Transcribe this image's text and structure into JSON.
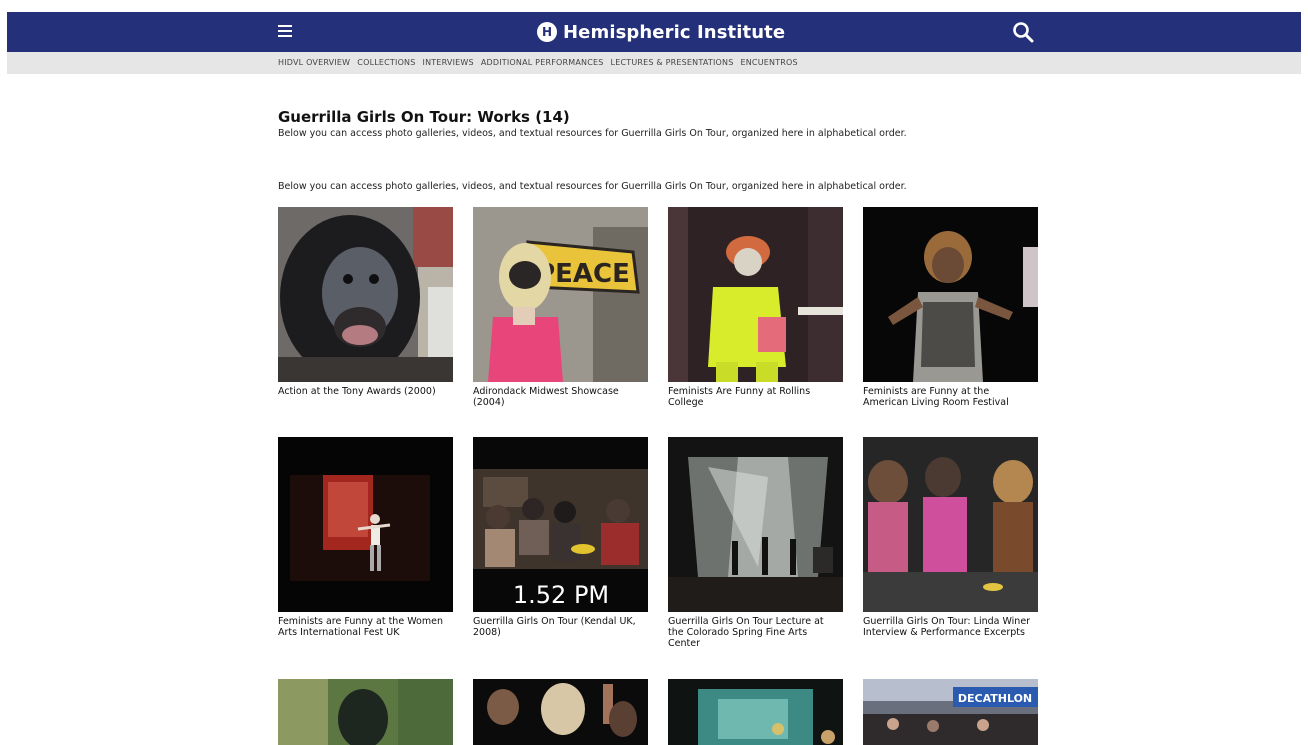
{
  "header": {
    "brand_name": "Hemispheric Institute",
    "brand_logo_letter": "H",
    "background_color": "#25307a",
    "menu_icon": "hamburger-icon",
    "search_icon": "search-icon"
  },
  "subnav": {
    "items": [
      "HIDVL OVERVIEW",
      "COLLECTIONS",
      "INTERVIEWS",
      "ADDITIONAL PERFORMANCES",
      "LECTURES & PRESENTATIONS",
      "ENCUENTROS"
    ]
  },
  "main": {
    "title": "Guerrilla Girls On Tour: Works (14)",
    "intro": "Below you can access photo galleries, videos, and textual resources for Guerrilla Girls On Tour, organized here in alphabetical order.",
    "intro_repeat": "Below you can access photo galleries, videos, and textual resources for Guerrilla Girls On Tour, organized here in alphabetical order.",
    "works": [
      {
        "title": "Action at the Tony Awards (2000)"
      },
      {
        "title": "Adirondack Midwest Showcase (2004)",
        "sign_text": "PEACE"
      },
      {
        "title": "Feminists Are Funny at Rollins College"
      },
      {
        "title": "Feminists are Funny at the American Living Room Festival"
      },
      {
        "title": "Feminists are Funny at the Women Arts International Fest UK"
      },
      {
        "title": "Guerrilla Girls On Tour (Kendal UK, 2008)",
        "overlay_text": "1.52 PM"
      },
      {
        "title": "Guerrilla Girls On Tour Lecture at the Colorado Spring Fine Arts Center"
      },
      {
        "title": "Guerrilla Girls On Tour: Linda Winer Interview & Performance Excerpts"
      },
      {
        "title": ""
      },
      {
        "title": ""
      },
      {
        "title": ""
      },
      {
        "title": "",
        "sign_text": "DECATHLON"
      }
    ]
  }
}
